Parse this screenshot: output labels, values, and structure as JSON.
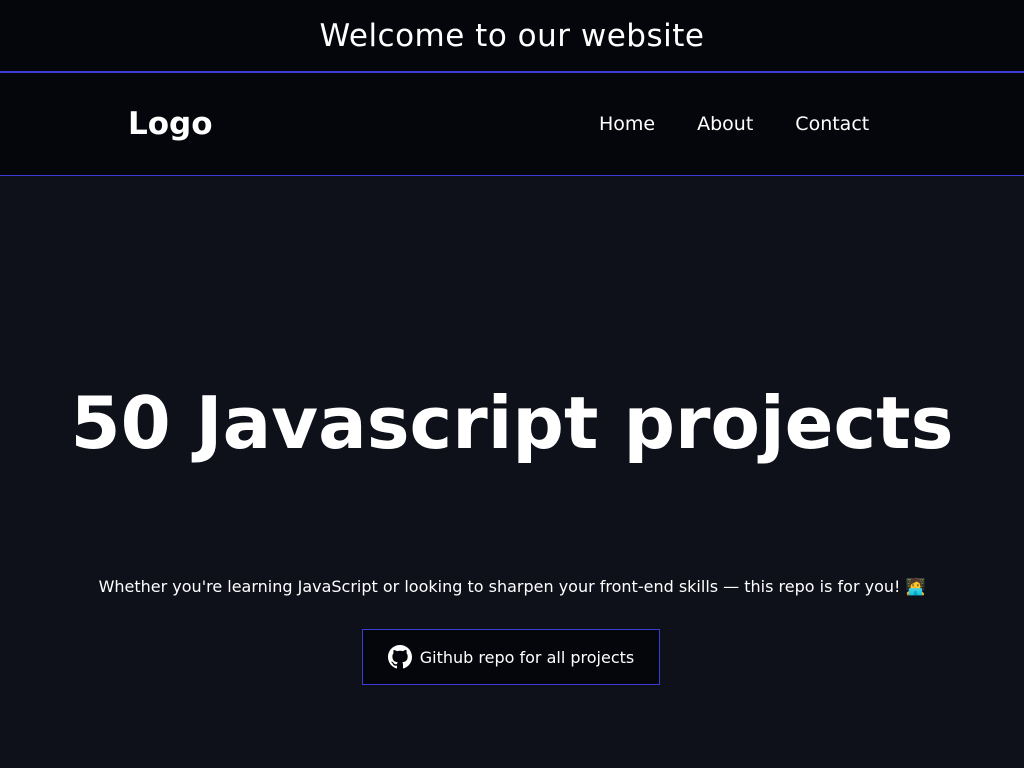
{
  "banner": {
    "text": "Welcome to our website"
  },
  "navbar": {
    "logo": "Logo",
    "links": [
      {
        "label": "Home"
      },
      {
        "label": "About"
      },
      {
        "label": "Contact"
      }
    ]
  },
  "hero": {
    "title": "50 Javascript projects",
    "subtitle": "Whether you're learning JavaScript or looking to sharpen your front-end skills — this repo is for you! 🧑‍💻",
    "button": {
      "label": "Github repo for all projects",
      "icon": "github-icon"
    }
  },
  "colors": {
    "background": "#0f111a",
    "header_background": "#05060b",
    "accent_border": "#3b3bd6",
    "text": "#ffffff"
  }
}
